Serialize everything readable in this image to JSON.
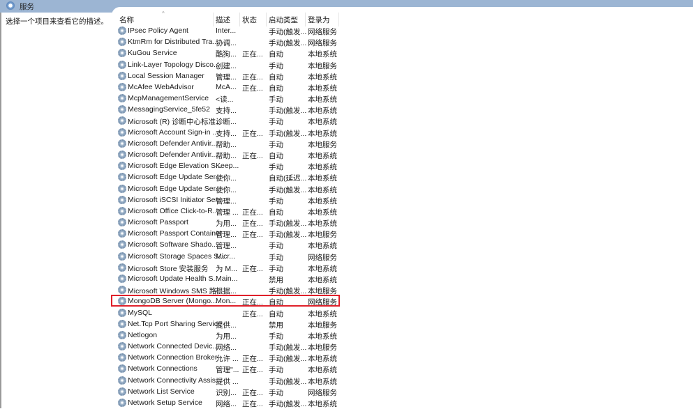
{
  "window": {
    "title": "服务"
  },
  "left_panel": {
    "description": "选择一个项目来查看它的描述。"
  },
  "columns": {
    "name": "名称",
    "desc": "描述",
    "status": "状态",
    "startup": "启动类型",
    "logon": "登录为"
  },
  "colors": {
    "highlight": "#e0202a",
    "titlebar": "#9cb5d3"
  },
  "highlighted_index": 24,
  "rows": [
    {
      "name": "IPsec Policy Agent",
      "desc": "Inter...",
      "status": "",
      "startup": "手动(触发...",
      "logon": "网络服务"
    },
    {
      "name": "KtmRm for Distributed Tra...",
      "desc": "协调...",
      "status": "",
      "startup": "手动(触发...",
      "logon": "网络服务"
    },
    {
      "name": "KuGou Service",
      "desc": "酷狗...",
      "status": "正在...",
      "startup": "自动",
      "logon": "本地系统"
    },
    {
      "name": "Link-Layer Topology Disco...",
      "desc": "创建...",
      "status": "",
      "startup": "手动",
      "logon": "本地服务"
    },
    {
      "name": "Local Session Manager",
      "desc": "管理...",
      "status": "正在...",
      "startup": "自动",
      "logon": "本地系统"
    },
    {
      "name": "McAfee WebAdvisor",
      "desc": "McA...",
      "status": "正在...",
      "startup": "自动",
      "logon": "本地系统"
    },
    {
      "name": "McpManagementService",
      "desc": "<读...",
      "status": "",
      "startup": "手动",
      "logon": "本地系统"
    },
    {
      "name": "MessagingService_5fe52",
      "desc": "支持...",
      "status": "",
      "startup": "手动(触发...",
      "logon": "本地系统"
    },
    {
      "name": "Microsoft (R) 诊断中心标准...",
      "desc": "诊断...",
      "status": "",
      "startup": "手动",
      "logon": "本地系统"
    },
    {
      "name": "Microsoft Account Sign-in ...",
      "desc": "支持...",
      "status": "正在...",
      "startup": "手动(触发...",
      "logon": "本地系统"
    },
    {
      "name": "Microsoft Defender Antivir...",
      "desc": "帮助...",
      "status": "",
      "startup": "手动",
      "logon": "本地服务"
    },
    {
      "name": "Microsoft Defender Antivir...",
      "desc": "帮助...",
      "status": "正在...",
      "startup": "自动",
      "logon": "本地系统"
    },
    {
      "name": "Microsoft Edge Elevation S...",
      "desc": "Keep...",
      "status": "",
      "startup": "手动",
      "logon": "本地系统"
    },
    {
      "name": "Microsoft Edge Update Ser...",
      "desc": "使你...",
      "status": "",
      "startup": "自动(延迟...",
      "logon": "本地系统"
    },
    {
      "name": "Microsoft Edge Update Ser...",
      "desc": "使你...",
      "status": "",
      "startup": "手动(触发...",
      "logon": "本地系统"
    },
    {
      "name": "Microsoft iSCSI Initiator Ser...",
      "desc": "管理...",
      "status": "",
      "startup": "手动",
      "logon": "本地系统"
    },
    {
      "name": "Microsoft Office Click-to-R...",
      "desc": "管理 ...",
      "status": "正在...",
      "startup": "自动",
      "logon": "本地系统"
    },
    {
      "name": "Microsoft Passport",
      "desc": "为用...",
      "status": "正在...",
      "startup": "手动(触发...",
      "logon": "本地系统"
    },
    {
      "name": "Microsoft Passport Container",
      "desc": "管理...",
      "status": "正在...",
      "startup": "手动(触发...",
      "logon": "本地服务"
    },
    {
      "name": "Microsoft Software Shado...",
      "desc": "管理...",
      "status": "",
      "startup": "手动",
      "logon": "本地系统"
    },
    {
      "name": "Microsoft Storage Spaces S...",
      "desc": "Micr...",
      "status": "",
      "startup": "手动",
      "logon": "网络服务"
    },
    {
      "name": "Microsoft Store 安装服务",
      "desc": "为 M...",
      "status": "正在...",
      "startup": "手动",
      "logon": "本地系统"
    },
    {
      "name": "Microsoft Update Health S...",
      "desc": "Main...",
      "status": "",
      "startup": "禁用",
      "logon": "本地系统"
    },
    {
      "name": "Microsoft Windows SMS 路...",
      "desc": "根据...",
      "status": "",
      "startup": "手动(触发...",
      "logon": "本地服务"
    },
    {
      "name": "MongoDB Server (Mongo...",
      "desc": "Mon...",
      "status": "正在...",
      "startup": "自动",
      "logon": "网络服务"
    },
    {
      "name": "MySQL",
      "desc": "",
      "status": "正在...",
      "startup": "自动",
      "logon": "本地系统"
    },
    {
      "name": "Net.Tcp Port Sharing Service",
      "desc": "提供...",
      "status": "",
      "startup": "禁用",
      "logon": "本地服务"
    },
    {
      "name": "Netlogon",
      "desc": "为用...",
      "status": "",
      "startup": "手动",
      "logon": "本地系统"
    },
    {
      "name": "Network Connected Devic...",
      "desc": "网络...",
      "status": "",
      "startup": "手动(触发...",
      "logon": "本地服务"
    },
    {
      "name": "Network Connection Broker",
      "desc": "允许 ...",
      "status": "正在...",
      "startup": "手动(触发...",
      "logon": "本地系统"
    },
    {
      "name": "Network Connections",
      "desc": "管理\"...",
      "status": "正在...",
      "startup": "手动",
      "logon": "本地系统"
    },
    {
      "name": "Network Connectivity Assis...",
      "desc": "提供 ...",
      "status": "",
      "startup": "手动(触发...",
      "logon": "本地系统"
    },
    {
      "name": "Network List Service",
      "desc": "识别...",
      "status": "正在...",
      "startup": "手动",
      "logon": "网络服务"
    },
    {
      "name": "Network Setup Service",
      "desc": "网络...",
      "status": "正在...",
      "startup": "手动(触发...",
      "logon": "本地系统"
    }
  ]
}
